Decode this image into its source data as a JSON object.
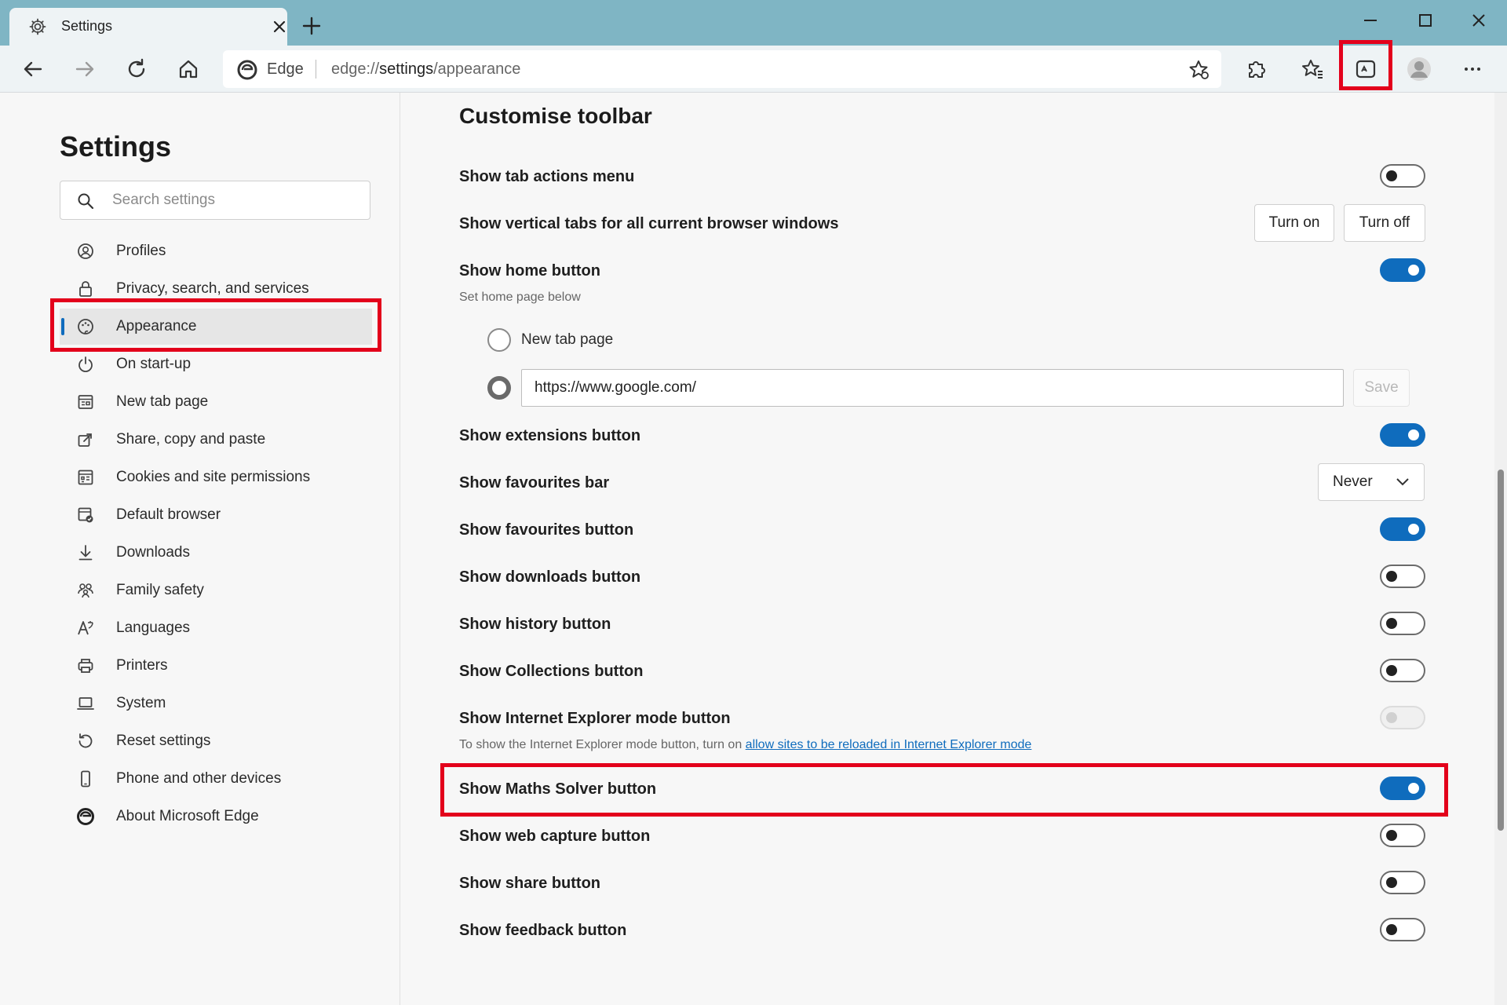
{
  "tab": {
    "title": "Settings",
    "icon": "gear-icon"
  },
  "toolbar": {
    "address_brand": "Edge",
    "url_prefix": "edge://",
    "url_path": "settings",
    "url_suffix": "/appearance"
  },
  "sidebar": {
    "title": "Settings",
    "search_placeholder": "Search settings",
    "items": [
      {
        "label": "Profiles",
        "icon": "profiles-icon"
      },
      {
        "label": "Privacy, search, and services",
        "icon": "lock-icon"
      },
      {
        "label": "Appearance",
        "icon": "appearance-icon",
        "active": true
      },
      {
        "label": "On start-up",
        "icon": "power-icon"
      },
      {
        "label": "New tab page",
        "icon": "new-tab-icon"
      },
      {
        "label": "Share, copy and paste",
        "icon": "share-icon"
      },
      {
        "label": "Cookies and site permissions",
        "icon": "cookies-icon"
      },
      {
        "label": "Default browser",
        "icon": "default-browser-icon"
      },
      {
        "label": "Downloads",
        "icon": "download-icon"
      },
      {
        "label": "Family safety",
        "icon": "family-icon"
      },
      {
        "label": "Languages",
        "icon": "languages-icon"
      },
      {
        "label": "Printers",
        "icon": "printer-icon"
      },
      {
        "label": "System",
        "icon": "laptop-icon"
      },
      {
        "label": "Reset settings",
        "icon": "reset-icon"
      },
      {
        "label": "Phone and other devices",
        "icon": "phone-icon"
      },
      {
        "label": "About Microsoft Edge",
        "icon": "edge-logo-icon"
      }
    ]
  },
  "main": {
    "section_title": "Customise toolbar",
    "rows": {
      "tab_actions": {
        "label": "Show tab actions menu",
        "on": false
      },
      "vertical_tabs": {
        "label": "Show vertical tabs for all current browser windows",
        "turn_on": "Turn on",
        "turn_off": "Turn off"
      },
      "home": {
        "label": "Show home button",
        "sub": "Set home page below",
        "on": true
      },
      "home_options": {
        "new_tab": "New tab page",
        "url_value": "https://www.google.com/",
        "save": "Save"
      },
      "extensions": {
        "label": "Show extensions button",
        "on": true
      },
      "fav_bar": {
        "label": "Show favourites bar",
        "value": "Never"
      },
      "fav_button": {
        "label": "Show favourites button",
        "on": true
      },
      "downloads": {
        "label": "Show downloads button",
        "on": false
      },
      "history": {
        "label": "Show history button",
        "on": false
      },
      "collections": {
        "label": "Show Collections button",
        "on": false
      },
      "ie_mode": {
        "label": "Show Internet Explorer mode button",
        "sub": "To show the Internet Explorer mode button, turn on",
        "link": "allow sites to be reloaded in Internet Explorer mode",
        "on": false,
        "disabled": true
      },
      "maths_solver": {
        "label": "Show Maths Solver button",
        "on": true
      },
      "web_capture": {
        "label": "Show web capture button",
        "on": false
      },
      "share": {
        "label": "Show share button",
        "on": false
      },
      "feedback": {
        "label": "Show feedback button",
        "on": false
      }
    }
  },
  "colors": {
    "accent": "#0f6cbd",
    "highlight": "#e3001b",
    "tabstrip": "#7fb5c4"
  }
}
